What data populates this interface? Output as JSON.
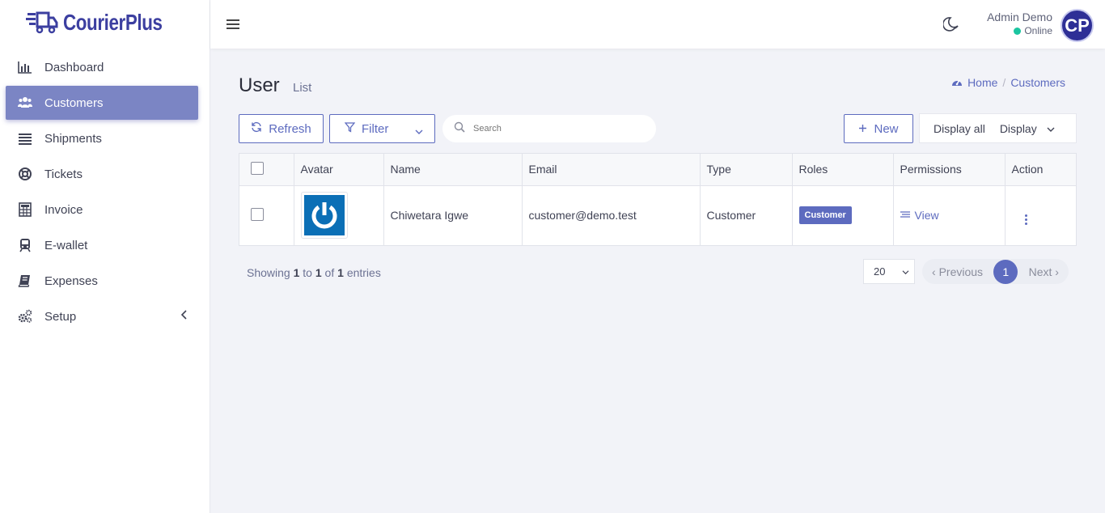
{
  "brand": {
    "name": "CourierPlus"
  },
  "sidebar": {
    "items": [
      {
        "label": "Dashboard",
        "icon": "bar-chart-icon"
      },
      {
        "label": "Customers",
        "icon": "users-icon"
      },
      {
        "label": "Shipments",
        "icon": "list-icon"
      },
      {
        "label": "Tickets",
        "icon": "lifebuoy-icon"
      },
      {
        "label": "Invoice",
        "icon": "calculator-icon"
      },
      {
        "label": "E-wallet",
        "icon": "train-icon"
      },
      {
        "label": "Expenses",
        "icon": "book-icon"
      },
      {
        "label": "Setup",
        "icon": "cogs-icon"
      }
    ]
  },
  "header": {
    "user_name": "Admin Demo",
    "user_status": "Online",
    "avatar_initials": "CP"
  },
  "page": {
    "title": "User",
    "subtitle": "List",
    "breadcrumb": {
      "home": "Home",
      "current": "Customers"
    }
  },
  "toolbar": {
    "refresh_label": "Refresh",
    "filter_label": "Filter",
    "search_placeholder": "Search",
    "new_label": "New",
    "display_all_label": "Display all",
    "display_label": "Display"
  },
  "table": {
    "columns": [
      "Avatar",
      "Name",
      "Email",
      "Type",
      "Roles",
      "Permissions",
      "Action"
    ],
    "rows": [
      {
        "name": "Chiwetara Igwe",
        "email": "customer@demo.test",
        "type": "Customer",
        "role": "Customer",
        "permissions": "View"
      }
    ]
  },
  "pagination": {
    "showing_prefix": "Showing",
    "from": "1",
    "to_word": "to",
    "to": "1",
    "of_word": "of",
    "total": "1",
    "entries_word": "entries",
    "per_page": "20",
    "previous": "Previous",
    "current_page": "1",
    "next": "Next"
  },
  "colors": {
    "accent": "#5d6bbf",
    "brand": "#3c3fa0",
    "online": "#1bc5a0"
  }
}
